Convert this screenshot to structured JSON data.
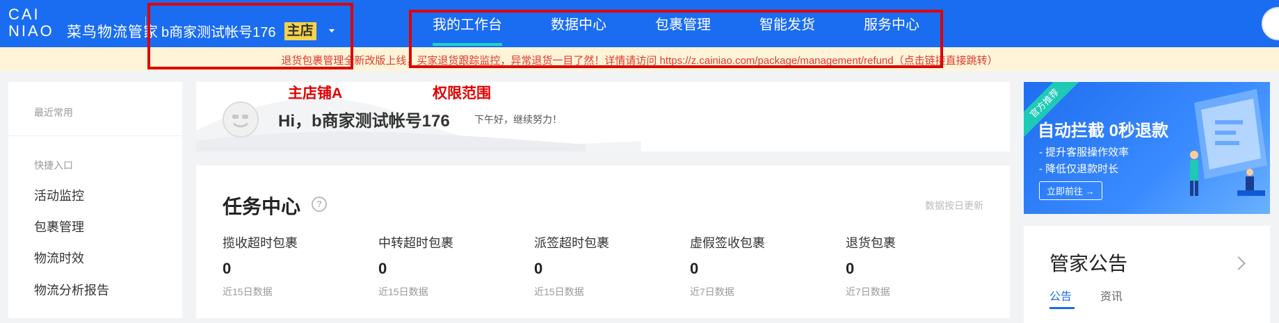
{
  "header": {
    "logo_mark": "CAI\nNIAO",
    "logo_name": "菜鸟物流管家",
    "account_name": "b商家测试帐号176",
    "main_badge": "主店",
    "nav": [
      "我的工作台",
      "数据中心",
      "包裹管理",
      "智能发货",
      "服务中心"
    ],
    "active_nav_index": 0,
    "brand_color": "#1a6df0",
    "active_underline_color": "#21d3c4"
  },
  "notice": {
    "text": "退货包裹管理全新改版上线，买家退货跟踪监控，异常退货一目了然！详情请访问 https://z.cainiao.com/package/management/refund（点击链接直接跳转）",
    "color": "#e03a2f"
  },
  "annotations": {
    "label_a": "主店铺A",
    "label_b": "权限范围",
    "color": "#e00000"
  },
  "sidebar": {
    "recent_title": "最近常用",
    "quick_title": "快捷入口",
    "links": [
      "活动监控",
      "包裹管理",
      "物流时效",
      "物流分析报告"
    ]
  },
  "greeting": {
    "title": "Hi，b商家测试帐号176",
    "subtitle": "下午好，继续努力！"
  },
  "task_center": {
    "title": "任务中心",
    "help_icon": "question-circle-icon",
    "note": "数据按日更新",
    "stats": [
      {
        "label": "揽收超时包裹",
        "value": "0",
        "range": "近15日数据"
      },
      {
        "label": "中转超时包裹",
        "value": "0",
        "range": "近15日数据"
      },
      {
        "label": "派签超时包裹",
        "value": "0",
        "range": "近15日数据"
      },
      {
        "label": "虚假签收包裹",
        "value": "0",
        "range": "近7日数据"
      },
      {
        "label": "退货包裹",
        "value": "0",
        "range": "近7日数据"
      }
    ]
  },
  "banner": {
    "ribbon": "官方推荐",
    "title": "自动拦截 0秒退款",
    "lines": [
      "- 提升客服操作效率",
      "- 降低仅退款时长"
    ],
    "button": "立即前往 →"
  },
  "notice_card": {
    "title": "管家公告",
    "tabs": [
      "公告",
      "资讯"
    ],
    "active_tab_index": 0
  }
}
